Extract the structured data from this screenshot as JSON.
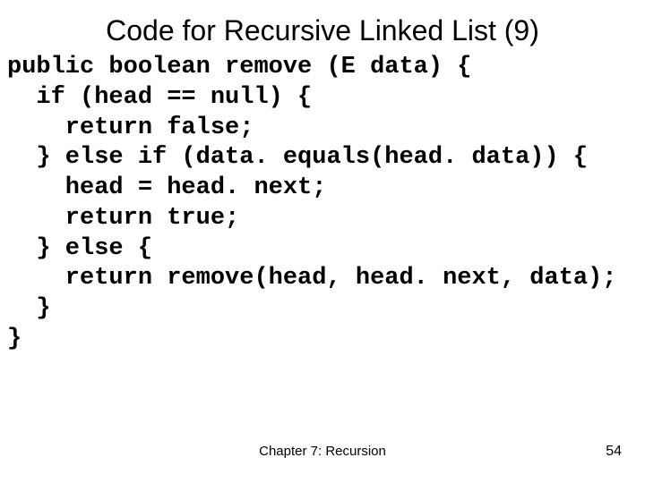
{
  "title": "Code for Recursive Linked List (9)",
  "code": {
    "l1": "public boolean remove (E data) {",
    "l2": "  if (head == null) {",
    "l3": "    return false;",
    "l4": "  } else if (data. equals(head. data)) {",
    "l5": "    head = head. next;",
    "l6": "    return true;",
    "l7": "  } else {",
    "l8": "    return remove(head, head. next, data);",
    "l9": "  }",
    "l10": "}"
  },
  "footer": {
    "chapter": "Chapter 7: Recursion",
    "page_number": "54"
  }
}
